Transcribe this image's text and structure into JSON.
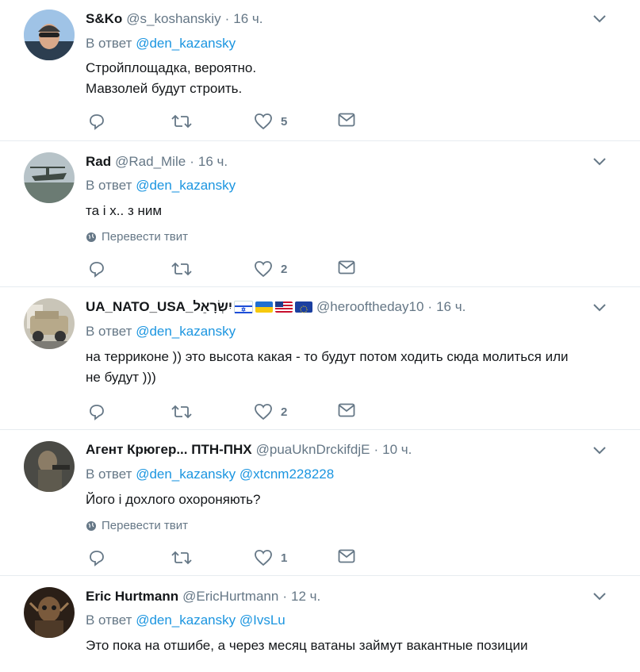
{
  "translate_label": "Перевести твит",
  "reply_prefix": "В ответ",
  "tweets": [
    {
      "name": "S&Ko",
      "handle": "@s_koshanskiy",
      "time": "16 ч.",
      "mentions": [
        "@den_kazansky"
      ],
      "text_lines": [
        "Стройплощадка, вероятно.",
        "Мавзолей будут строить."
      ],
      "likes": "5",
      "translate": false
    },
    {
      "name": "Rad",
      "handle": "@Rad_Mile",
      "time": "16 ч.",
      "mentions": [
        "@den_kazansky"
      ],
      "text_lines": [
        "та і х.. з ним"
      ],
      "likes": "2",
      "translate": true
    },
    {
      "name": "UA_NATO_USA_יִשְׂרָאֵל",
      "handle": "@herooftheday10",
      "time": "16 ч.",
      "mentions": [
        "@den_kazansky"
      ],
      "text_lines": [
        "на терриконе )) это высота какая - то будут потом ходить сюда молиться или",
        "не будут )))"
      ],
      "likes": "2",
      "translate": false,
      "flags": [
        "israel",
        "ukraine",
        "usa",
        "eu"
      ]
    },
    {
      "name": "Агент Крюгер... ПТН-ПНХ",
      "handle": "@puaUknDrckifdjE",
      "time": "10 ч.",
      "mentions": [
        "@den_kazansky",
        "@xtcnm228228"
      ],
      "text_lines": [
        "Його і дохлого охороняють?"
      ],
      "likes": "1",
      "translate": true
    },
    {
      "name": "Eric Hurtmann",
      "handle": "@EricHurtmann",
      "time": "12 ч.",
      "mentions": [
        "@den_kazansky",
        "@IvsLu"
      ],
      "text_lines": [
        "Это пока на отшибе, а через месяц ватаны займут вакантные позиции"
      ],
      "likes": "",
      "translate": false
    }
  ]
}
